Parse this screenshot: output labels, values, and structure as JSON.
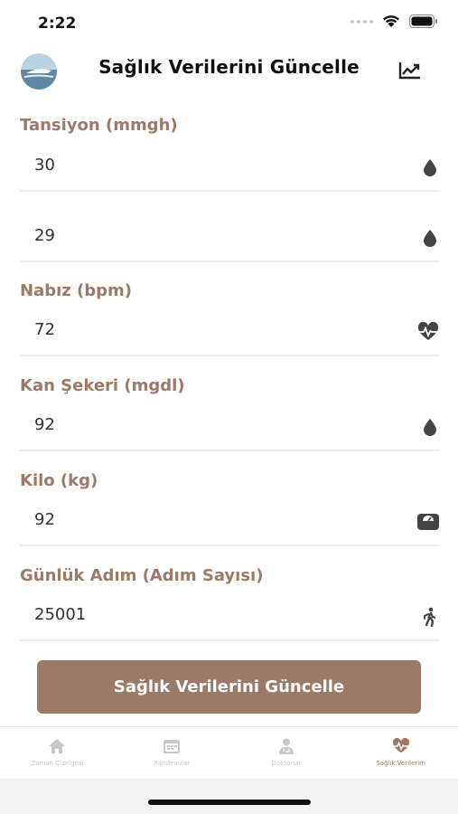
{
  "status_bar": {
    "time": "2:22"
  },
  "header": {
    "title": "Sağlık Verilerini Güncelle"
  },
  "form": {
    "blood_pressure": {
      "label": "Tansiyon (mmgh)",
      "systolic": "30",
      "diastolic": "29"
    },
    "pulse": {
      "label": "Nabız (bpm)",
      "value": "72"
    },
    "blood_sugar": {
      "label": "Kan Şekeri (mgdl)",
      "value": "92"
    },
    "weight": {
      "label": "Kilo (kg)",
      "value": "92"
    },
    "steps": {
      "label": "Günlük Adım (Adım Sayısı)",
      "value": "25001"
    },
    "submit_label": "Sağlık Verilerini Güncelle"
  },
  "tabs": [
    {
      "label": "Zaman Çizelgesi",
      "icon": "home-icon"
    },
    {
      "label": "Randevular",
      "icon": "calendar-icon"
    },
    {
      "label": "Doktorlar",
      "icon": "doctor-icon"
    },
    {
      "label": "Sağlık Verilerim",
      "icon": "heart-pulse-icon"
    }
  ],
  "active_tab": 3,
  "colors": {
    "accent": "#9c7a66",
    "divider": "#ececec",
    "icon": "#444444"
  }
}
